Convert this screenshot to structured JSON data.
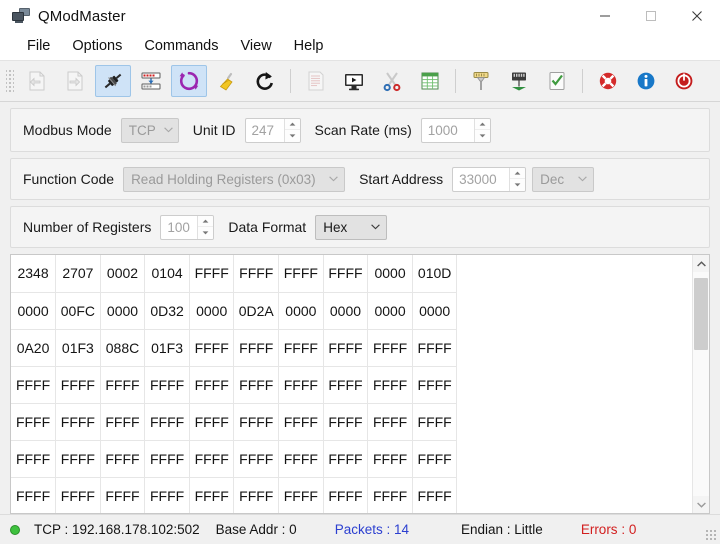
{
  "window": {
    "title": "QModMaster",
    "icon": "computers-icon",
    "controls": [
      {
        "name": "minimize-button",
        "glyph": "minimize-icon"
      },
      {
        "name": "maximize-button",
        "glyph": "maximize-icon"
      },
      {
        "name": "close-button",
        "glyph": "close-icon"
      }
    ]
  },
  "menubar": {
    "items": [
      {
        "label": "File"
      },
      {
        "label": "Options"
      },
      {
        "label": "Commands"
      },
      {
        "label": "View"
      },
      {
        "label": "Help"
      }
    ]
  },
  "toolbar": {
    "buttons": [
      {
        "name": "open-file-button",
        "icon": "open-file-icon",
        "state": "disabled"
      },
      {
        "name": "save-file-button",
        "icon": "save-file-icon",
        "state": "disabled"
      },
      {
        "name": "connect-button",
        "icon": "connector-plug-icon",
        "state": "checked"
      },
      {
        "name": "settings-button",
        "icon": "modbus-settings-icon",
        "state": "normal"
      },
      {
        "name": "scan-button",
        "icon": "refresh-cycle-icon",
        "state": "checked"
      },
      {
        "name": "clear-button",
        "icon": "broom-icon",
        "state": "normal"
      },
      {
        "name": "read-write-once-button",
        "icon": "reload-arrow-icon",
        "state": "normal"
      },
      {
        "name": "separator-1",
        "icon": "separator",
        "state": "separator"
      },
      {
        "name": "log-button",
        "icon": "document-lines-icon",
        "state": "disabled"
      },
      {
        "name": "bus-monitor-button",
        "icon": "monitor-play-icon",
        "state": "normal"
      },
      {
        "name": "cut-button",
        "icon": "scissors-icon",
        "state": "normal"
      },
      {
        "name": "table-view-button",
        "icon": "spreadsheet-icon",
        "state": "normal"
      },
      {
        "name": "separator-2",
        "icon": "separator",
        "state": "separator"
      },
      {
        "name": "serial-port-button",
        "icon": "serial-port-icon",
        "state": "normal"
      },
      {
        "name": "network-port-button",
        "icon": "network-jack-icon",
        "state": "normal"
      },
      {
        "name": "check-list-button",
        "icon": "checklist-icon",
        "state": "normal"
      },
      {
        "name": "separator-3",
        "icon": "separator",
        "state": "separator"
      },
      {
        "name": "help-button",
        "icon": "lifebuoy-icon",
        "state": "normal"
      },
      {
        "name": "about-button",
        "icon": "info-circle-icon",
        "state": "normal"
      },
      {
        "name": "quit-button",
        "icon": "power-off-icon",
        "state": "normal"
      }
    ]
  },
  "form": {
    "row1": {
      "modbus_mode_label": "Modbus Mode",
      "modbus_mode_value": "TCP",
      "unit_id_label": "Unit ID",
      "unit_id_value": "247",
      "scan_rate_label": "Scan Rate (ms)",
      "scan_rate_value": "1000"
    },
    "row2": {
      "function_code_label": "Function Code",
      "function_code_value": "Read Holding Registers (0x03)",
      "start_address_label": "Start Address",
      "start_address_value": "33000",
      "base_value": "Dec"
    },
    "row3": {
      "number_of_registers_label": "Number of Registers",
      "number_of_registers_value": "100",
      "data_format_label": "Data Format",
      "data_format_value": "Hex"
    }
  },
  "grid": {
    "columns": 10,
    "rows": [
      [
        "2348",
        "2707",
        "0002",
        "0104",
        "FFFF",
        "FFFF",
        "FFFF",
        "FFFF",
        "0000",
        "010D"
      ],
      [
        "0000",
        "00FC",
        "0000",
        "0D32",
        "0000",
        "0D2A",
        "0000",
        "0000",
        "0000",
        "0000"
      ],
      [
        "0A20",
        "01F3",
        "088C",
        "01F3",
        "FFFF",
        "FFFF",
        "FFFF",
        "FFFF",
        "FFFF",
        "FFFF"
      ],
      [
        "FFFF",
        "FFFF",
        "FFFF",
        "FFFF",
        "FFFF",
        "FFFF",
        "FFFF",
        "FFFF",
        "FFFF",
        "FFFF"
      ],
      [
        "FFFF",
        "FFFF",
        "FFFF",
        "FFFF",
        "FFFF",
        "FFFF",
        "FFFF",
        "FFFF",
        "FFFF",
        "FFFF"
      ],
      [
        "FFFF",
        "FFFF",
        "FFFF",
        "FFFF",
        "FFFF",
        "FFFF",
        "FFFF",
        "FFFF",
        "FFFF",
        "FFFF"
      ],
      [
        "FFFF",
        "FFFF",
        "FFFF",
        "FFFF",
        "FFFF",
        "FFFF",
        "FFFF",
        "FFFF",
        "FFFF",
        "FFFF"
      ]
    ]
  },
  "statusbar": {
    "connection_led": "connected",
    "connection": "TCP : 192.168.178.102:502",
    "base_addr": "Base Addr : 0",
    "packets": "Packets : 14",
    "endian": "Endian : Little",
    "errors": "Errors : 0"
  },
  "colors": {
    "accent_checked": "#cfe3f7",
    "led_green": "#3ec13e",
    "packets_blue": "#2b3fd0",
    "errors_red": "#d21f1f"
  }
}
